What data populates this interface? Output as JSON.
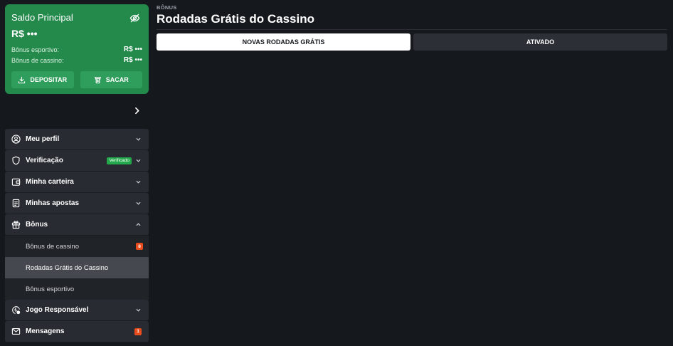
{
  "balance": {
    "title": "Saldo Principal",
    "amount": "R$ •••",
    "sports_label": "Bônus esportivo:",
    "sports_value": "R$ •••",
    "casino_label": "Bônus de cassino:",
    "casino_value": "R$ •••",
    "deposit_label": "DEPOSITAR",
    "withdraw_label": "SACAR",
    "accent_color": "#248a4c"
  },
  "menu": {
    "profile": "Meu perfil",
    "verification": "Verificação",
    "verified_badge": "Verificado",
    "wallet": "Minha carteira",
    "bets": "Minhas apostas",
    "bonus": "Bônus",
    "bonus_sub": {
      "casino": "Bônus de cassino",
      "casino_count": "8",
      "free_spins": "Rodadas Grátis do Cassino",
      "sports": "Bônus esportivo"
    },
    "responsible": "Jogo Responsável",
    "messages": "Mensagens",
    "messages_count": "1"
  },
  "main": {
    "breadcrumb": "BÔNUS",
    "title": "Rodadas Grátis do Cassino",
    "tabs": [
      {
        "label": "NOVAS RODADAS GRÁTIS",
        "active": true
      },
      {
        "label": "ATIVADO",
        "active": false
      }
    ]
  },
  "icons": {
    "hide_balance": "eye-off-icon",
    "deposit": "download-icon",
    "withdraw": "withdraw-icon",
    "collapse": "chevron-right-icon",
    "profile": "user-circle-icon",
    "verification": "shield-icon",
    "wallet": "wallet-icon",
    "bets": "receipt-icon",
    "bonus": "gift-icon",
    "responsible": "responsible-gaming-icon",
    "messages": "mail-icon"
  }
}
